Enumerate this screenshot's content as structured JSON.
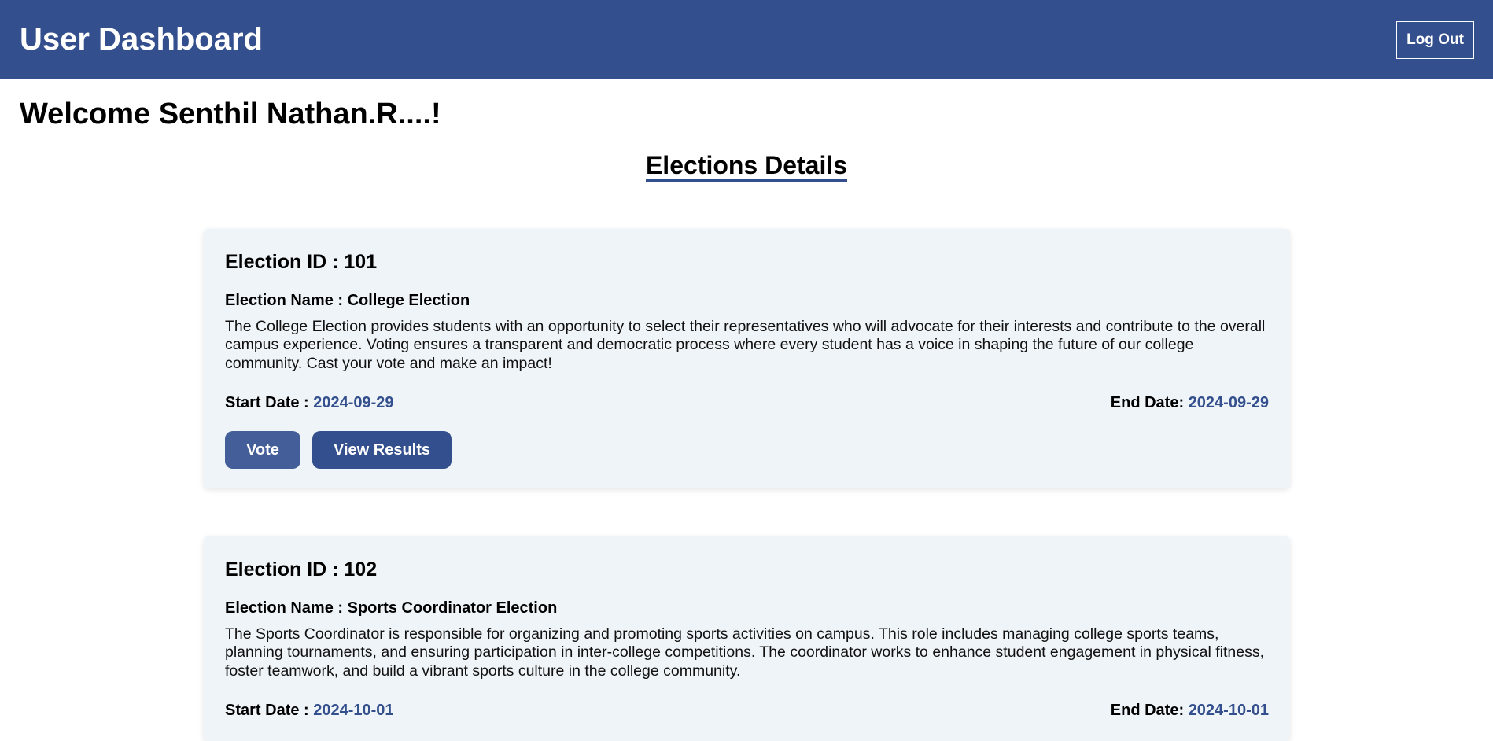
{
  "header": {
    "title": "User Dashboard",
    "logout_label": "Log Out"
  },
  "welcome": "Welcome Senthil Nathan.R....!",
  "section_title": "Elections Details",
  "elections": [
    {
      "id_text": "Election ID : 101",
      "name_label": "Election Name : ",
      "name_value": "College Election",
      "description": "The College Election provides students with an opportunity to select their representatives who will advocate for their interests and contribute to the overall campus experience. Voting ensures a transparent and democratic process where every student has a voice in shaping the future of our college community. Cast your vote and make an impact!",
      "start_label": "Start Date : ",
      "start_date": "2024-09-29",
      "end_label": "End Date: ",
      "end_date": "2024-09-29",
      "vote_label": "Vote",
      "results_label": "View Results"
    },
    {
      "id_text": "Election ID : 102",
      "name_label": "Election Name : ",
      "name_value": "Sports Coordinator Election",
      "description": "The Sports Coordinator is responsible for organizing and promoting sports activities on campus. This role includes managing college sports teams, planning tournaments, and ensuring participation in inter-college competitions. The coordinator works to enhance student engagement in physical fitness, foster teamwork, and build a vibrant sports culture in the college community.",
      "start_label": "Start Date : ",
      "start_date": "2024-10-01",
      "end_label": "End Date: ",
      "end_date": "2024-10-01"
    }
  ],
  "colors": {
    "primary": "#344f8d",
    "vote_button": "#435e99",
    "card_background": "#eff4f8"
  }
}
